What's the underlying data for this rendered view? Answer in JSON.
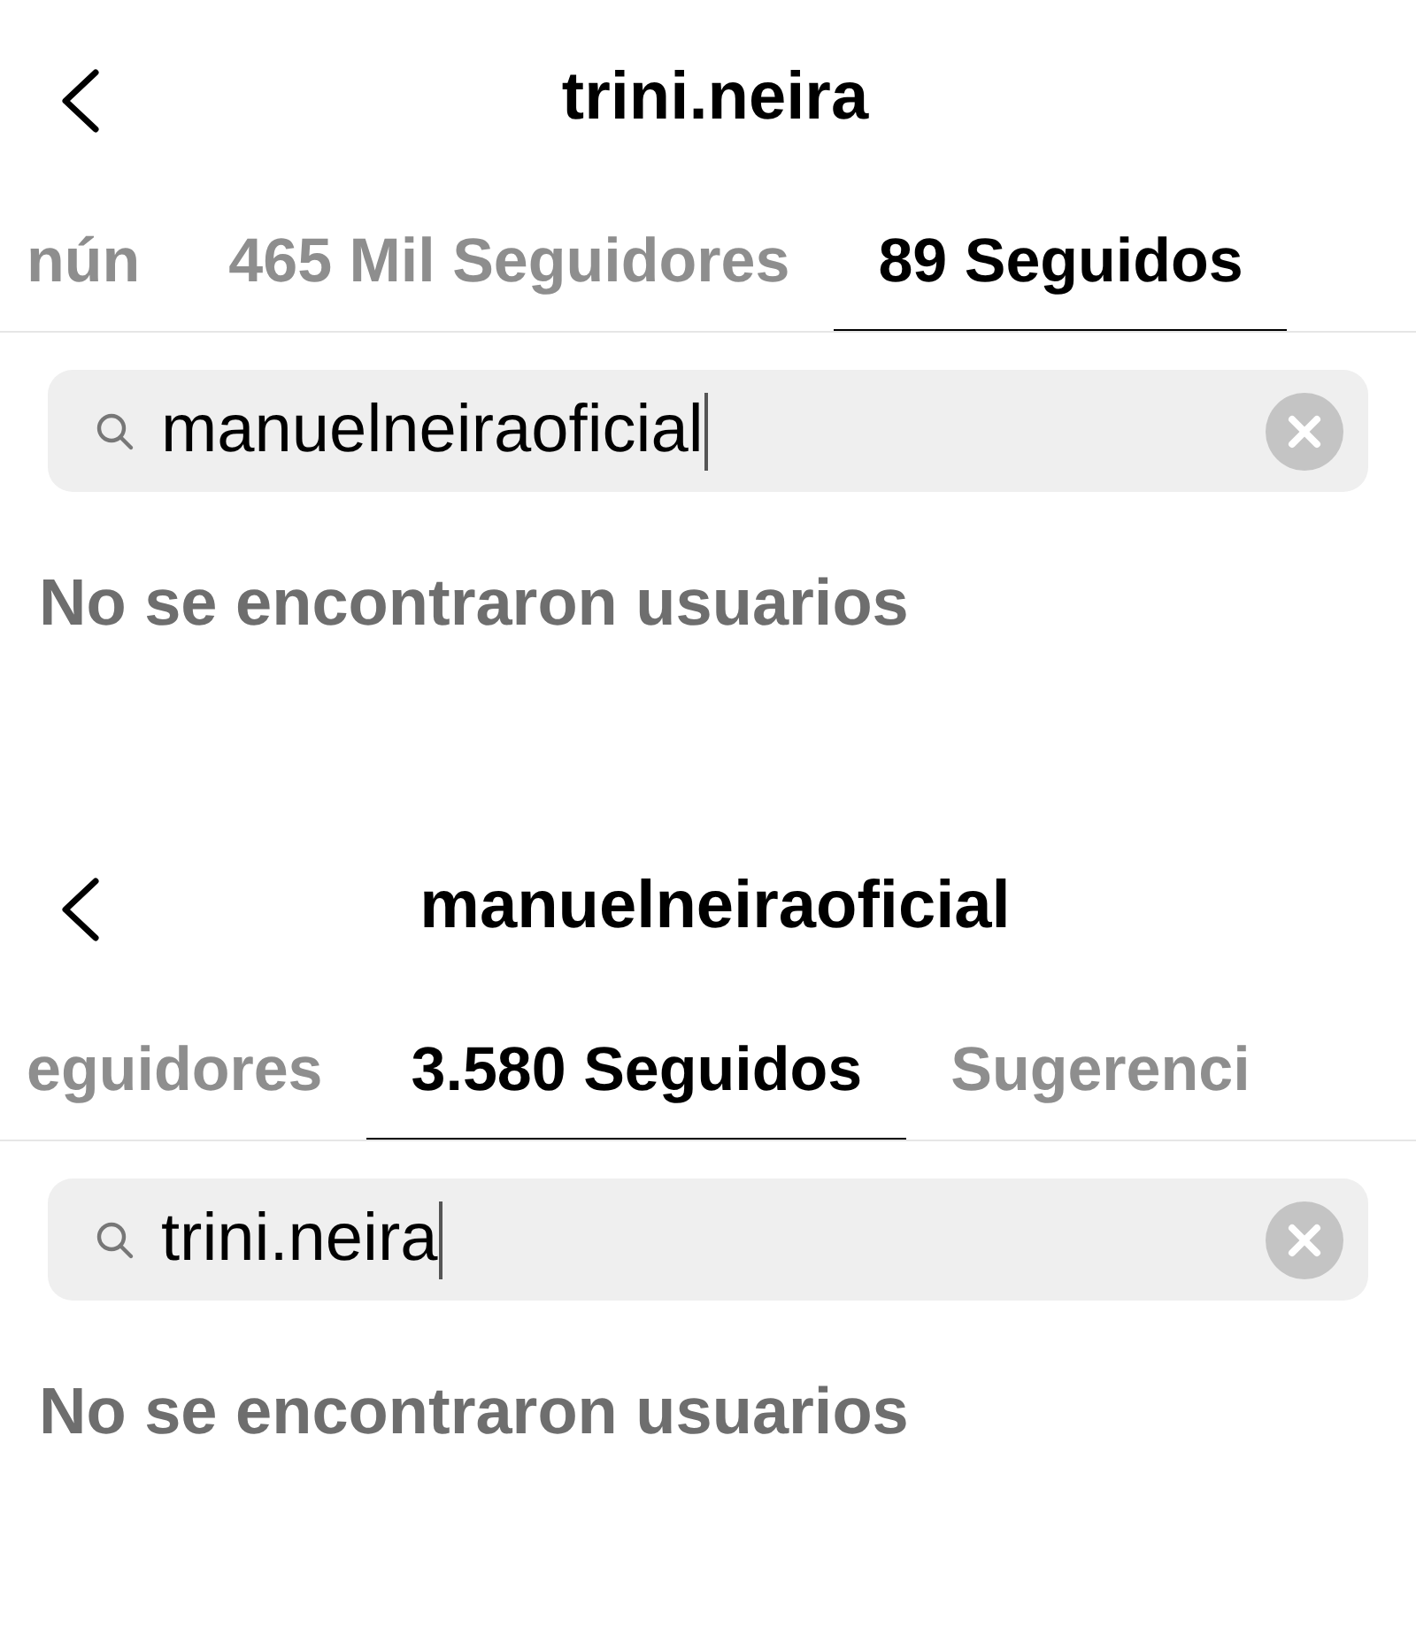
{
  "panels": [
    {
      "title": "trini.neira",
      "tabs": [
        {
          "label": "nún",
          "selected": false
        },
        {
          "label": "465 Mil Seguidores",
          "selected": false
        },
        {
          "label": "89 Seguidos",
          "selected": true
        }
      ],
      "search": {
        "value": "manuelneiraoficial"
      },
      "message": "No se encontraron usuarios"
    },
    {
      "title": "manuelneiraoficial",
      "tabs": [
        {
          "label": "eguidores",
          "selected": false
        },
        {
          "label": "3.580 Seguidos",
          "selected": true
        },
        {
          "label": "Sugerenci",
          "selected": false
        }
      ],
      "search": {
        "value": "trini.neira"
      },
      "message": "No se encontraron usuarios"
    }
  ]
}
